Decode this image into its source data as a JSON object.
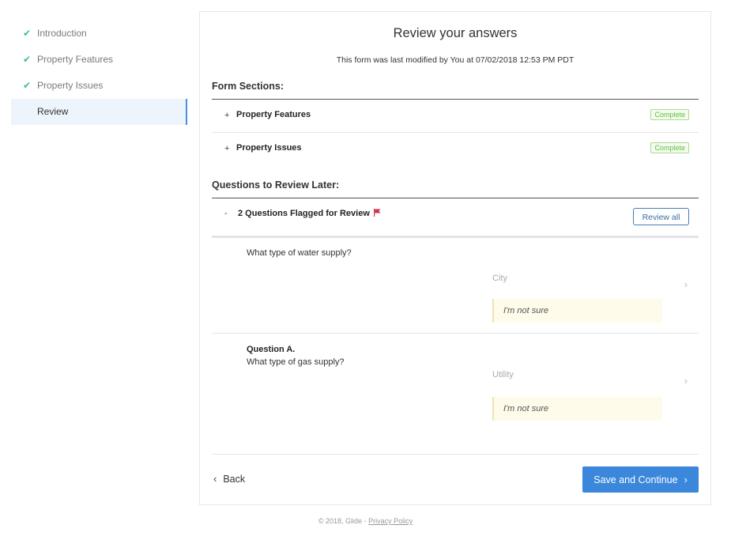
{
  "sidebar": {
    "items": [
      {
        "label": "Introduction",
        "done": true
      },
      {
        "label": "Property Features",
        "done": true
      },
      {
        "label": "Property Issues",
        "done": true
      },
      {
        "label": "Review",
        "done": false,
        "active": true
      }
    ]
  },
  "main": {
    "title": "Review your answers",
    "modified": "This form was last modified by You at 07/02/2018 12:53 PM PDT",
    "form_sections_heading": "Form Sections:",
    "sections": [
      {
        "toggle": "+",
        "label": "Property Features",
        "status": "Complete"
      },
      {
        "toggle": "+",
        "label": "Property Issues",
        "status": "Complete"
      }
    ],
    "review_later_heading": "Questions to Review Later:",
    "flagged": {
      "toggle": "-",
      "label": "2 Questions Flagged for Review",
      "review_all_label": "Review all"
    },
    "questions": [
      {
        "title": "",
        "text": "What type of water supply?",
        "answer": "City",
        "note": "I'm not sure"
      },
      {
        "title": "Question A.",
        "text": "What type of gas supply?",
        "answer": "Utility",
        "note": "I'm not sure"
      }
    ],
    "back_label": "Back",
    "save_label": "Save and Continue"
  },
  "footer": {
    "copyright": "© 2018, Glide - ",
    "privacy_label": "Privacy Policy"
  },
  "colors": {
    "accent": "#3a87db",
    "check": "#3cc47c",
    "complete": "#5fbf3d",
    "flag": "#d0334d",
    "note_bg": "#fffbeb"
  }
}
